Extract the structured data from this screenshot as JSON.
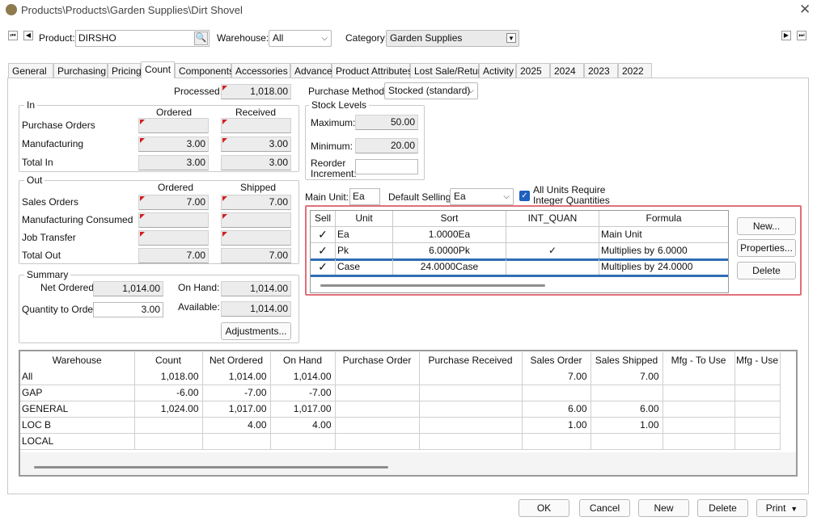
{
  "window": {
    "title": "Products\\Products\\Garden Supplies\\Dirt Shovel"
  },
  "header": {
    "product_label": "Product:",
    "product_value": "DIRSHO",
    "warehouse_label": "Warehouse:",
    "warehouse_value": "All",
    "category_label": "Category:",
    "category_value": "Garden Supplies"
  },
  "tabs": [
    "General",
    "Purchasing",
    "Pricing",
    "Count",
    "Components",
    "Accessories",
    "Advanced",
    "Product Attributes",
    "Lost Sale/Return",
    "Activity",
    "2025",
    "2024",
    "2023",
    "2022"
  ],
  "active_tab": "Count",
  "processed": {
    "label": "Processed:",
    "value": "1,018.00"
  },
  "in": {
    "title": "In",
    "col_ordered": "Ordered",
    "col_received": "Received",
    "rows": [
      {
        "label": "Purchase Orders",
        "ordered": "",
        "received": ""
      },
      {
        "label": "Manufacturing",
        "ordered": "3.00",
        "received": "3.00"
      },
      {
        "label": "Total In",
        "ordered": "3.00",
        "received": "3.00"
      }
    ]
  },
  "out": {
    "title": "Out",
    "col_ordered": "Ordered",
    "col_shipped": "Shipped",
    "rows": [
      {
        "label": "Sales Orders",
        "ordered": "7.00",
        "shipped": "7.00"
      },
      {
        "label": "Manufacturing Consumed",
        "ordered": "",
        "shipped": ""
      },
      {
        "label": "Job Transfer",
        "ordered": "",
        "shipped": ""
      },
      {
        "label": "Total Out",
        "ordered": "7.00",
        "shipped": "7.00"
      }
    ]
  },
  "summary": {
    "title": "Summary",
    "net_ordered_label": "Net Ordered:",
    "net_ordered": "1,014.00",
    "on_hand_label": "On Hand:",
    "on_hand": "1,014.00",
    "qty_to_order_label": "Quantity to Order:",
    "qty_to_order": "3.00",
    "available_label": "Available:",
    "available": "1,014.00",
    "adjustments_label": "Adjustments..."
  },
  "purchase_method": {
    "label": "Purchase Method:",
    "value": "Stocked (standard)"
  },
  "stock_levels": {
    "title": "Stock Levels",
    "maximum_label": "Maximum:",
    "maximum": "50.00",
    "minimum_label": "Minimum:",
    "minimum": "20.00",
    "reorder_label_1": "Reorder",
    "reorder_label_2": "Increment:",
    "reorder": ""
  },
  "units": {
    "main_unit_label": "Main Unit:",
    "main_unit": "Ea",
    "default_selling_label": "Default Selling:",
    "default_selling": "Ea",
    "integer_label_1": "All Units Require",
    "integer_label_2": "Integer Quantities",
    "headers": [
      "Sell",
      "Unit",
      "Sort",
      "INT_QUAN",
      "Formula"
    ],
    "rows": [
      {
        "sell": "✓",
        "unit": "Ea",
        "sort": "1.0000Ea",
        "int_quan": "",
        "formula": "Main Unit",
        "formula_value": ""
      },
      {
        "sell": "✓",
        "unit": "Pk",
        "sort": "6.0000Pk",
        "int_quan": "✓",
        "formula": "Multiplies by",
        "formula_value": "6.0000"
      },
      {
        "sell": "✓",
        "unit": "Case",
        "sort": "24.0000Case",
        "int_quan": "",
        "formula": "Multiplies by",
        "formula_value": "24.0000"
      }
    ],
    "new_label": "New...",
    "properties_label": "Properties...",
    "delete_label": "Delete"
  },
  "warehouse_grid": {
    "headers": [
      "Warehouse",
      "Count",
      "Net Ordered",
      "On Hand",
      "Purchase Order",
      "Purchase Received",
      "Sales Order",
      "Sales Shipped",
      "Mfg - To Use",
      "Mfg - Use"
    ],
    "rows": [
      [
        "All",
        "1,018.00",
        "1,014.00",
        "1,014.00",
        "",
        "",
        "7.00",
        "7.00",
        "",
        ""
      ],
      [
        "GAP",
        "-6.00",
        "-7.00",
        "-7.00",
        "",
        "",
        "",
        "",
        "",
        ""
      ],
      [
        "GENERAL",
        "1,024.00",
        "1,017.00",
        "1,017.00",
        "",
        "",
        "6.00",
        "6.00",
        "",
        ""
      ],
      [
        "LOC B",
        "",
        "4.00",
        "4.00",
        "",
        "",
        "1.00",
        "1.00",
        "",
        ""
      ],
      [
        "LOCAL",
        "",
        "",
        "",
        "",
        "",
        "",
        "",
        "",
        ""
      ]
    ]
  },
  "footer": {
    "ok": "OK",
    "cancel": "Cancel",
    "new": "New",
    "delete": "Delete",
    "print": "Print"
  },
  "colors": {
    "highlight_border": "#e0707a",
    "selection_line": "#2f6db5",
    "flag": "#d11f1f"
  }
}
